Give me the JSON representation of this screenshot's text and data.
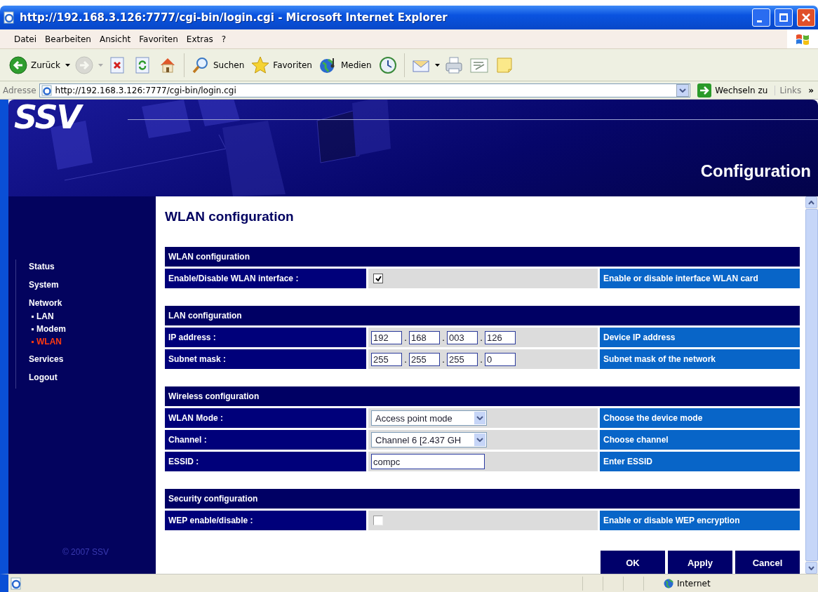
{
  "window": {
    "title": "http://192.168.3.126:7777/cgi-bin/login.cgi - Microsoft Internet Explorer"
  },
  "menu_bar": [
    "Datei",
    "Bearbeiten",
    "Ansicht",
    "Favoriten",
    "Extras",
    "?"
  ],
  "toolbar": [
    {
      "kind": "back",
      "label": "Zurück",
      "dropdown": true,
      "disabled": false
    },
    {
      "kind": "forward",
      "dropdown": true,
      "disabled": true
    },
    {
      "kind": "stop",
      "dropdown": false,
      "disabled": false
    },
    {
      "kind": "refresh",
      "dropdown": false,
      "disabled": false
    },
    {
      "kind": "home",
      "dropdown": false,
      "disabled": false
    },
    {
      "kind": "search",
      "label": "Suchen",
      "dropdown": false,
      "disabled": false
    },
    {
      "kind": "favorites",
      "label": "Favoriten",
      "dropdown": false,
      "disabled": false
    },
    {
      "kind": "media",
      "label": "Medien",
      "dropdown": false,
      "disabled": false
    },
    {
      "kind": "history",
      "dropdown": false,
      "disabled": false
    },
    {
      "kind": "mail",
      "dropdown": true,
      "disabled": false
    },
    {
      "kind": "print",
      "dropdown": false,
      "disabled": false
    },
    {
      "kind": "edit",
      "dropdown": false,
      "disabled": false
    },
    {
      "kind": "note",
      "dropdown": false,
      "disabled": false
    }
  ],
  "address_bar": {
    "label": "Adresse",
    "url": "http://192.168.3.126:7777/cgi-bin/login.cgi",
    "go_button": "Wechseln zu",
    "links": "Links",
    "more": "»"
  },
  "header": {
    "logo": "SSV",
    "title": "Configuration"
  },
  "sidebar": {
    "items": [
      {
        "label": "Status",
        "selected": false
      },
      {
        "label": "System",
        "selected": false
      },
      {
        "label": "Network",
        "selected": false,
        "children": [
          {
            "label": "LAN",
            "selected": false
          },
          {
            "label": "Modem",
            "selected": false
          },
          {
            "label": "WLAN",
            "selected": true
          }
        ]
      },
      {
        "label": "Services",
        "selected": false
      },
      {
        "label": "Logout",
        "selected": false
      }
    ],
    "copyright": "© 2007 SSV"
  },
  "page": {
    "heading": "WLAN configuration",
    "sections": [
      {
        "title": "WLAN configuration",
        "rows": [
          {
            "kind": "checkbox",
            "label": "Enable/Disable WLAN interface :",
            "checked": true,
            "description": "Enable or disable interface WLAN card"
          }
        ]
      },
      {
        "title": "LAN configuration",
        "rows": [
          {
            "kind": "ip",
            "label": "IP address :",
            "octets": [
              "192",
              "168",
              "003",
              "126"
            ],
            "separator": ".",
            "description": "Device IP address"
          },
          {
            "kind": "ip",
            "label": "Subnet mask :",
            "octets": [
              "255",
              "255",
              "255",
              "0"
            ],
            "separator": ".",
            "description": "Subnet mask of the network"
          }
        ]
      },
      {
        "title": "Wireless configuration",
        "rows": [
          {
            "kind": "select",
            "label": "WLAN Mode :",
            "value": "Access point mode",
            "description": "Choose the device mode"
          },
          {
            "kind": "select",
            "label": "Channel :",
            "value": "Channel 6 [2.437 GH",
            "description": "Choose channel"
          },
          {
            "kind": "text",
            "label": "ESSID :",
            "value": "compc",
            "description": "Enter ESSID"
          }
        ]
      },
      {
        "title": "Security configuration",
        "rows": [
          {
            "kind": "checkbox",
            "label": "WEP enable/disable :",
            "checked": false,
            "description": "Enable or disable WEP encryption"
          }
        ]
      }
    ],
    "buttons": [
      "OK",
      "Apply",
      "Cancel"
    ]
  },
  "status_bar": {
    "zone": "Internet"
  }
}
